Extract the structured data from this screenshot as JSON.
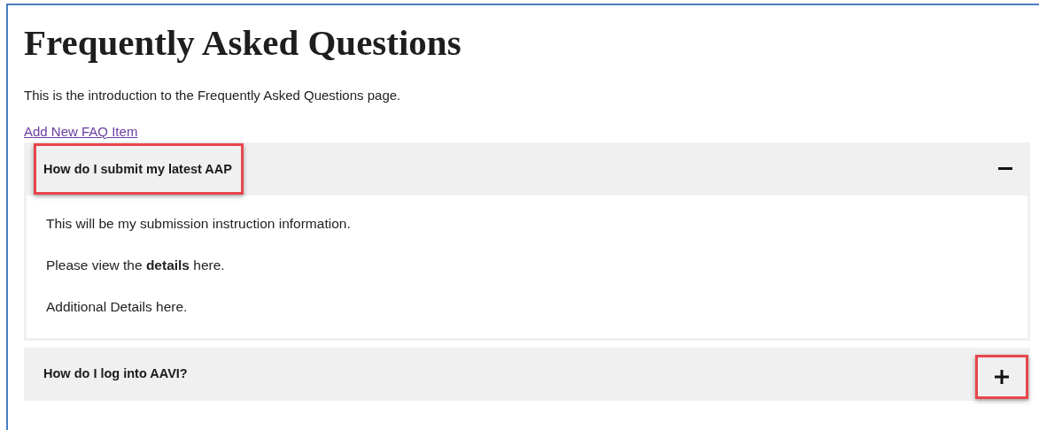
{
  "title": "Frequently Asked Questions",
  "intro": "This is the introduction to the Frequently Asked Questions page.",
  "add_link": "Add New FAQ Item",
  "faq_items": [
    {
      "question": "How do I submit my latest AAP",
      "expanded": true,
      "question_highlighted": true,
      "toggle_highlighted": false,
      "answer": [
        "This will be my submission instruction information.",
        "Please view the **details** here.",
        "Additional Details here."
      ]
    },
    {
      "question": "How do I log into AAVI?",
      "expanded": false,
      "question_highlighted": false,
      "toggle_highlighted": true
    }
  ]
}
